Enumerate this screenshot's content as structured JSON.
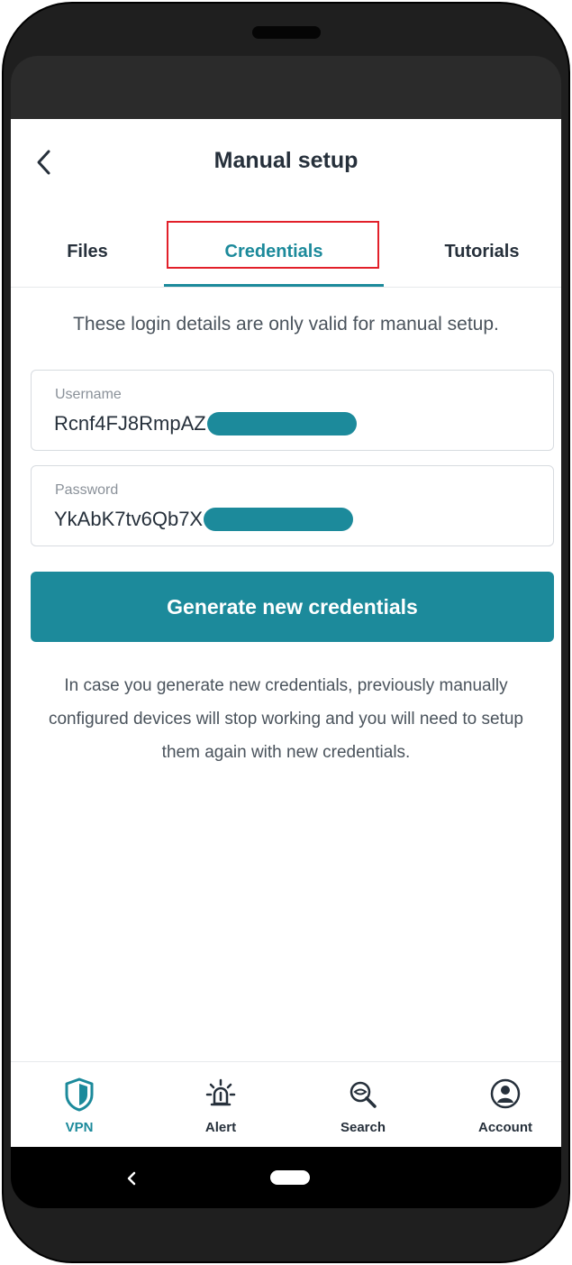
{
  "header": {
    "title": "Manual setup"
  },
  "tabs": [
    {
      "label": "Files"
    },
    {
      "label": "Credentials"
    },
    {
      "label": "Tutorials"
    }
  ],
  "info_text": "These login details are only valid for manual setup.",
  "username": {
    "label": "Username",
    "value": "Rcnf4FJ8RmpAZ"
  },
  "password": {
    "label": "Password",
    "value": "YkAbK7tv6Qb7X"
  },
  "generate_button": "Generate new credentials",
  "warning_text": "In case you generate new credentials, previously manually configured devices will stop working and you will need to setup them again with new credentials.",
  "bottom_nav": [
    {
      "label": "VPN",
      "icon": "shield-icon"
    },
    {
      "label": "Alert",
      "icon": "alarm-icon"
    },
    {
      "label": "Search",
      "icon": "search-icon"
    },
    {
      "label": "Account",
      "icon": "account-icon"
    }
  ],
  "colors": {
    "accent": "#1c8a9b",
    "text": "#26303b",
    "highlight": "#e2202a"
  }
}
